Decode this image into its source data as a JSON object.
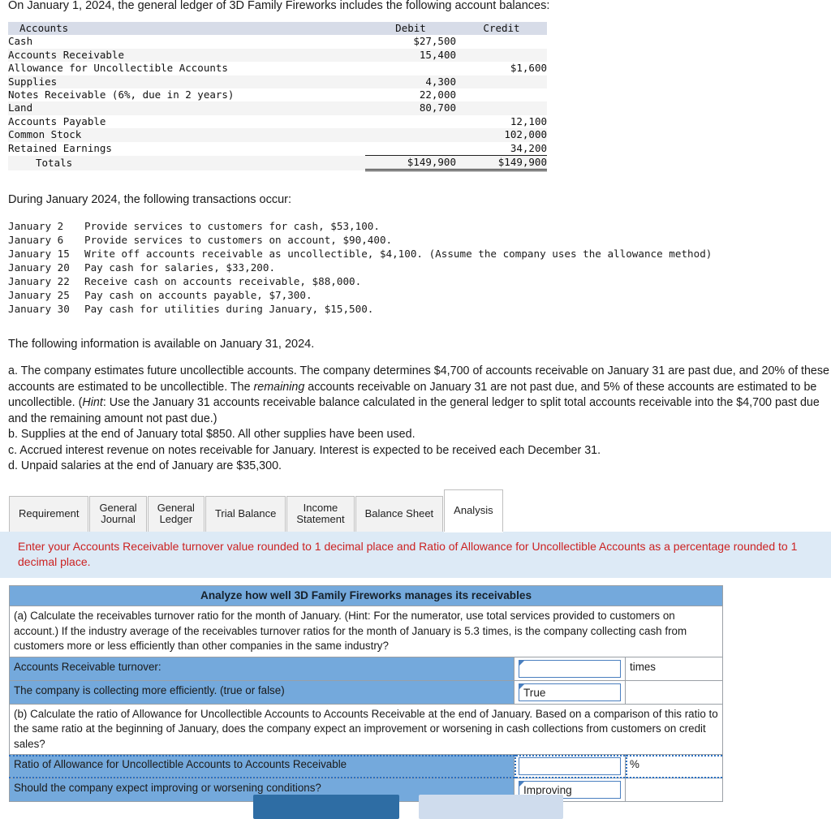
{
  "intro": {
    "text": "On January 1, 2024, the general ledger of 3D Family Fireworks includes the following account balances:"
  },
  "ledger": {
    "columns": [
      "Accounts",
      "Debit",
      "Credit"
    ],
    "rows": [
      {
        "account": "Cash",
        "debit": "$27,500",
        "credit": ""
      },
      {
        "account": "Accounts Receivable",
        "debit": "15,400",
        "credit": ""
      },
      {
        "account": "Allowance for Uncollectible Accounts",
        "debit": "",
        "credit": "$1,600"
      },
      {
        "account": "Supplies",
        "debit": "4,300",
        "credit": ""
      },
      {
        "account": "Notes Receivable (6%, due in 2 years)",
        "debit": "22,000",
        "credit": ""
      },
      {
        "account": "Land",
        "debit": "80,700",
        "credit": ""
      },
      {
        "account": "Accounts Payable",
        "debit": "",
        "credit": "12,100"
      },
      {
        "account": "Common Stock",
        "debit": "",
        "credit": "102,000"
      },
      {
        "account": "Retained Earnings",
        "debit": "",
        "credit": "34,200"
      }
    ],
    "totals": {
      "account": "Totals",
      "debit": "$149,900",
      "credit": "$149,900"
    }
  },
  "transactions": {
    "heading": "During January 2024, the following transactions occur:",
    "items": [
      {
        "date": "January 2",
        "description": "Provide services to customers for cash, $53,100."
      },
      {
        "date": "January 6",
        "description": "Provide services to customers on account, $90,400."
      },
      {
        "date": "January 15",
        "description": "Write off accounts receivable as uncollectible, $4,100. (Assume the company uses the allowance method)"
      },
      {
        "date": "January 20",
        "description": "Pay cash for salaries, $33,200."
      },
      {
        "date": "January 22",
        "description": "Receive cash on accounts receivable, $88,000."
      },
      {
        "date": "January 25",
        "description": "Pay cash on accounts payable, $7,300."
      },
      {
        "date": "January 30",
        "description": "Pay cash for utilities during January, $15,500."
      }
    ]
  },
  "adjusting": {
    "heading": "The following information is available on January 31, 2024.",
    "a_part1": "a. The company estimates future uncollectible accounts. The company determines $4,700 of accounts receivable on January 31 are past due, and 20% of these accounts are estimated to be uncollectible. The ",
    "a_italic1": "remaining",
    "a_part2": " accounts receivable on January 31 are not past due, and 5% of these accounts are estimated to be uncollectible. (",
    "a_italic2": "Hint",
    "a_part3": ": Use the January 31 accounts receivable balance calculated in the general ledger to split total accounts receivable into the $4,700 past due and the remaining amount not past due.)",
    "b": "b. Supplies at the end of January total $850. All other supplies have been used.",
    "c": "c. Accrued interest revenue on notes receivable for January. Interest is expected to be received each December 31.",
    "d": "d. Unpaid salaries at the end of January are $35,300."
  },
  "tabs": {
    "items": [
      {
        "label": "Requirement",
        "active": false
      },
      {
        "label": "General\nJournal",
        "active": false
      },
      {
        "label": "General\nLedger",
        "active": false
      },
      {
        "label": "Trial Balance",
        "active": false
      },
      {
        "label": "Income\nStatement",
        "active": false
      },
      {
        "label": "Balance Sheet",
        "active": false
      },
      {
        "label": "Analysis",
        "active": true
      }
    ]
  },
  "notice": {
    "text": "Enter your Accounts Receivable turnover value rounded to 1 decimal place and Ratio of Allowance for Uncollectible Accounts as a percentage rounded to 1 decimal place.",
    "color": "#cc2222",
    "background": "#ddeaf6"
  },
  "analysis": {
    "title": "Analyze how well 3D Family Fireworks manages its receivables",
    "accent_color": "#74a9dc",
    "prompt_a": "(a) Calculate the receivables turnover ratio for the month of January. (Hint: For the numerator, use total services provided to customers on account.) If the industry average of the receivables turnover ratios for the month of January is 5.3 times, is the company collecting cash from customers more or less efficiently than other companies in the same industry?",
    "row_a1_label": "Accounts Receivable turnover:",
    "row_a1_value": "",
    "row_a1_unit": "times",
    "row_a2_label": "The company is collecting more efficiently. (true or false)",
    "row_a2_value": "True",
    "row_a2_unit": "",
    "prompt_b": "(b) Calculate the ratio of Allowance for Uncollectible Accounts to Accounts Receivable at the end of January. Based on a comparison of this ratio to the same ratio at the beginning of January, does the company expect an improvement or worsening in cash collections from customers on credit sales?",
    "row_b1_label": "Ratio of Allowance for Uncollectible Accounts to Accounts Receivable",
    "row_b1_value": "",
    "row_b1_unit": "%",
    "row_b2_label": "Should the company expect improving or worsening conditions?",
    "row_b2_value": "Improving",
    "row_b2_unit": ""
  },
  "footer_buttons": {
    "primary_label": "",
    "secondary_label": ""
  }
}
